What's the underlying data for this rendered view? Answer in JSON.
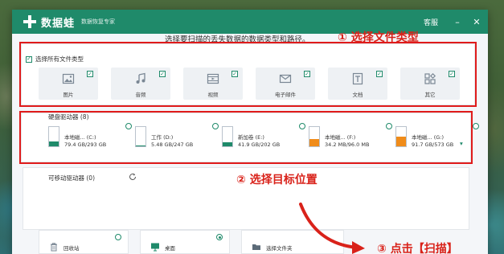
{
  "window": {
    "app_name": "数据蛙",
    "app_subtitle": "数据恢复专家",
    "support_label": "客服",
    "minimize_glyph": "–",
    "close_glyph": "✕"
  },
  "instruction": "选择要扫描的丢失数据的数据类型和路径。",
  "callouts": {
    "step1": "① 选择文件类型",
    "step2": "② 选择目标位置",
    "step3": "③ 点击【扫描】"
  },
  "file_types": {
    "select_all_label": "选择所有文件类型",
    "select_all_checked": true,
    "items": [
      {
        "label": "图片",
        "icon": "image-icon",
        "checked": true
      },
      {
        "label": "音频",
        "icon": "music-icon",
        "checked": true
      },
      {
        "label": "视频",
        "icon": "video-icon",
        "checked": true
      },
      {
        "label": "电子邮件",
        "icon": "mail-icon",
        "checked": true
      },
      {
        "label": "文档",
        "icon": "document-icon",
        "checked": true
      },
      {
        "label": "其它",
        "icon": "other-icon",
        "checked": true
      }
    ]
  },
  "drives": {
    "section_label": "硬盘驱动器 (8)",
    "items": [
      {
        "name": "本地磁... (C:)",
        "size": "79.4 GB/293 GB",
        "used_fraction": 0.27,
        "color": "#1f8a6a"
      },
      {
        "name": "工作 (D:)",
        "size": "5.48 GB/247 GB",
        "used_fraction": 0.02,
        "color": "#1f8a6a"
      },
      {
        "name": "新加卷 (E:)",
        "size": "41.9 GB/202 GB",
        "used_fraction": 0.21,
        "color": "#1f8a6a"
      },
      {
        "name": "本地磁... (F:)",
        "size": "34.2 MB/96.0 MB",
        "used_fraction": 0.36,
        "color": "#f08c1a"
      },
      {
        "name": "本地磁... (G:)",
        "size": "91.7 GB/573 GB",
        "used_fraction": 0.5,
        "color": "#f08c1a"
      }
    ],
    "scrollbar_glyph": "▾"
  },
  "removable": {
    "section_label": "可移动驱动器 (0)"
  },
  "locations": [
    {
      "label": "回收站",
      "icon": "trash-icon",
      "selected": false
    },
    {
      "label": "桌面",
      "icon": "desktop-icon",
      "selected": true
    },
    {
      "label": "选择文件夹",
      "icon": "folder-icon",
      "selected": false
    }
  ],
  "colors": {
    "brand": "#1f8a6a",
    "callout_red": "#d9221a",
    "drive_warning": "#f08c1a"
  }
}
